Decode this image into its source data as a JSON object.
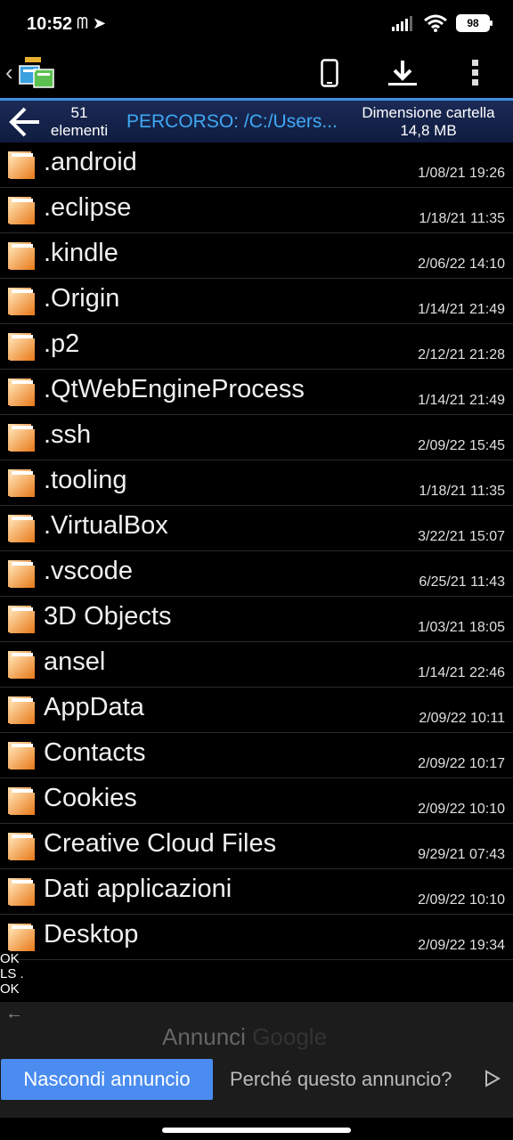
{
  "status_bar": {
    "time": "10:52",
    "time_icons": "ᗰ ➤",
    "battery": "98"
  },
  "header": {
    "count_number": "51",
    "count_label": "elementi",
    "path": "PERCORSO: /C:/Users...",
    "size_label": "Dimensione cartella",
    "size_value": "14,8 MB"
  },
  "files": [
    {
      "name": ".android",
      "date": "1/08/21 19:26"
    },
    {
      "name": ".eclipse",
      "date": "1/18/21 11:35"
    },
    {
      "name": ".kindle",
      "date": "2/06/22 14:10"
    },
    {
      "name": ".Origin",
      "date": "1/14/21 21:49"
    },
    {
      "name": ".p2",
      "date": "2/12/21 21:28"
    },
    {
      "name": ".QtWebEngineProcess",
      "date": "1/14/21 21:49"
    },
    {
      "name": ".ssh",
      "date": "2/09/22 15:45"
    },
    {
      "name": ".tooling",
      "date": "1/18/21 11:35"
    },
    {
      "name": ".VirtualBox",
      "date": "3/22/21 15:07"
    },
    {
      "name": ".vscode",
      "date": "6/25/21 11:43"
    },
    {
      "name": "3D Objects",
      "date": "1/03/21 18:05"
    },
    {
      "name": "ansel",
      "date": "1/14/21 22:46"
    },
    {
      "name": "AppData",
      "date": "2/09/22 10:11"
    },
    {
      "name": "Contacts",
      "date": "2/09/22 10:17"
    },
    {
      "name": "Cookies",
      "date": "2/09/22 10:10"
    },
    {
      "name": "Creative Cloud Files",
      "date": "9/29/21 07:43"
    },
    {
      "name": "Dati applicazioni",
      "date": "2/09/22 10:10"
    },
    {
      "name": "Desktop",
      "date": "2/09/22 19:34"
    }
  ],
  "stray_text": [
    "OK",
    "LS .",
    "OK"
  ],
  "ad": {
    "label": "Annunci",
    "brand": "Google",
    "hide_button": "Nascondi annuncio",
    "why": "Perché questo annuncio?"
  },
  "colors": {
    "header_bg": "#0f1c40",
    "path_text": "#3fa9f5",
    "accent_line": "#3d8fe0",
    "hide_button": "#4a8cf0"
  },
  "icons": [
    "signal-icon",
    "wifi-icon",
    "battery-icon",
    "app-logo-icon",
    "phone-icon",
    "download-icon",
    "more-icon",
    "back-arrow-icon",
    "folder-icon",
    "ad-choices-icon"
  ]
}
